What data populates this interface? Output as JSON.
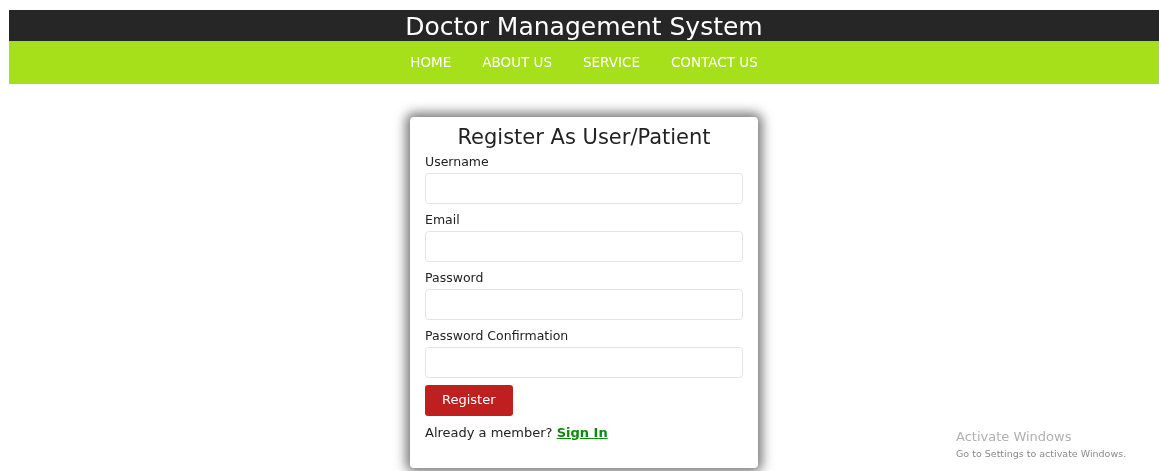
{
  "site": {
    "title": "Doctor Management System"
  },
  "nav": [
    {
      "label": "HOME"
    },
    {
      "label": "ABOUT US"
    },
    {
      "label": "SERVICE"
    },
    {
      "label": "CONTACT US"
    }
  ],
  "form": {
    "title": "Register As User/Patient",
    "fields": [
      {
        "label": "Username"
      },
      {
        "label": "Email"
      },
      {
        "label": "Password"
      },
      {
        "label": "Password Confirmation"
      }
    ],
    "submit": "Register",
    "footer_text": "Already a member?",
    "footer_link": "Sign In"
  },
  "os_notice": {
    "title": "Activate Windows",
    "subtitle": "Go to Settings to activate Windows."
  }
}
